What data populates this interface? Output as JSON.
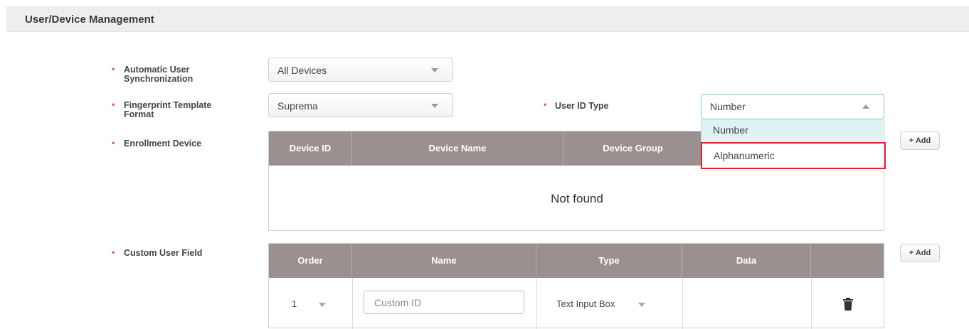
{
  "section": {
    "title": "User/Device Management"
  },
  "fields": {
    "auto_sync": {
      "label": "Automatic User Synchronization",
      "value": "All Devices"
    },
    "fp_format": {
      "label": "Fingerprint Template Format",
      "value": "Suprema"
    },
    "user_id_type": {
      "label": "User ID Type",
      "value": "Number",
      "options": [
        "Number",
        "Alphanumeric"
      ]
    },
    "enrollment": {
      "label": "Enrollment Device",
      "columns": [
        "Device ID",
        "Device Name",
        "Device Group"
      ],
      "empty_text": "Not found",
      "add_label": "+ Add"
    },
    "custom_field": {
      "label": "Custom User Field",
      "columns": [
        "Order",
        "Name",
        "Type",
        "Data",
        ""
      ],
      "add_label": "+ Add",
      "rows": [
        {
          "order": "1",
          "name": "Custom ID",
          "type": "Text Input Box",
          "data": ""
        }
      ]
    }
  },
  "colors": {
    "table_header": "#9a9090",
    "highlight_box": "#e2222e",
    "bullet": "#e05555",
    "selected_option": "#dff3f2"
  }
}
